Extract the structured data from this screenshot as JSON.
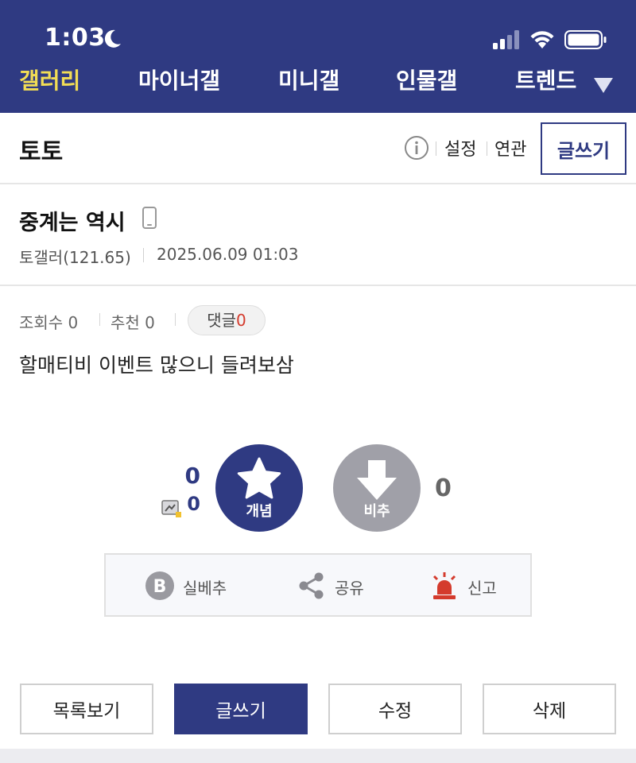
{
  "status_bar": {
    "time": "1:03"
  },
  "nav": {
    "items": [
      "갤러리",
      "마이너갤",
      "미니갤",
      "인물갤",
      "트렌드"
    ]
  },
  "gallery": {
    "title": "토토",
    "settings_label": "설정",
    "related_label": "연관",
    "write_label": "글쓰기"
  },
  "post": {
    "title": "중계는 역시",
    "author": "토갤러(121.65)",
    "date": "2025.06.09 01:03",
    "views_label": "조회수 0",
    "recommend_label": "추천 0",
    "comment_label": "댓글",
    "comment_count": "0",
    "body": "할매티비 이벤트 많으니 들려보삼"
  },
  "vote": {
    "up_count": "0",
    "fixed_count": "0",
    "up_label": "개념",
    "down_label": "비추",
    "down_count": "0"
  },
  "actions": {
    "best_label": "실베추",
    "share_label": "공유",
    "report_label": "신고"
  },
  "bottom": {
    "list_label": "목록보기",
    "write_label": "글쓰기",
    "edit_label": "수정",
    "delete_label": "삭제"
  },
  "colors": {
    "brand": "#2f3a82",
    "active_nav": "#f2dd55",
    "alert_red": "#d43b2d",
    "downvote_gray": "#a0a0a8"
  }
}
